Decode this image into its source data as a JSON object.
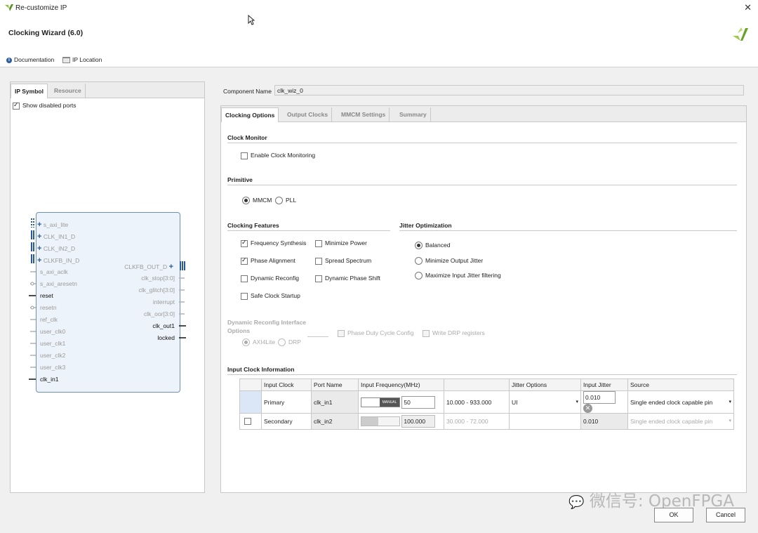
{
  "window": {
    "title": "Re-customize IP"
  },
  "header": {
    "title": "Clocking Wizard (6.0)",
    "links": [
      "Documentation",
      "IP Location"
    ]
  },
  "left_panel": {
    "tabs": [
      "IP Symbol",
      "Resource"
    ],
    "show_disabled_ports": "Show disabled ports",
    "symbol": {
      "left_ports": [
        "s_axi_lite",
        "CLK_IN1_D",
        "CLK_IN2_D",
        "CLKFB_IN_D",
        "s_axi_aclk",
        "s_axi_aresetn",
        "reset",
        "resetn",
        "ref_clk",
        "user_clk0",
        "user_clk1",
        "user_clk2",
        "user_clk3",
        "clk_in1"
      ],
      "right_ports": [
        "CLKFB_OUT_D",
        "clk_stop[3:0]",
        "clk_glitch[3:0]",
        "interrupt",
        "clk_oor[3:0]",
        "clk_out1",
        "locked"
      ]
    }
  },
  "component": {
    "label": "Component Name",
    "value": "clk_wiz_0"
  },
  "tabs": [
    "Clocking Options",
    "Output Clocks",
    "MMCM Settings",
    "Summary"
  ],
  "clock_monitor": {
    "title": "Clock Monitor",
    "enable": "Enable Clock Monitoring"
  },
  "primitive": {
    "title": "Primitive",
    "options": [
      "MMCM",
      "PLL"
    ]
  },
  "clocking_features": {
    "title": "Clocking Features",
    "options": [
      "Frequency Synthesis",
      "Minimize Power",
      "Phase Alignment",
      "Spread Spectrum",
      "Dynamic Reconfig",
      "Dynamic Phase Shift",
      "Safe Clock Startup"
    ]
  },
  "jitter_optimization": {
    "title": "Jitter Optimization",
    "options": [
      "Balanced",
      "Minimize Output Jitter",
      "Maximize Input Jitter filtering"
    ]
  },
  "drp": {
    "title_line1": "Dynamic Reconfig Interface",
    "title_line2": "Options",
    "options": [
      "AXI4Lite",
      "DRP"
    ],
    "phase_duty": "Phase Duty Cycle Config",
    "write_drp": "Write DRP registers"
  },
  "input_clock": {
    "title": "Input Clock Information",
    "headers": [
      "Input Clock",
      "Port Name",
      "Input Frequency(MHz)",
      "",
      "Jitter Options",
      "Input Jitter",
      "Source"
    ],
    "rows": [
      {
        "name": "Primary",
        "port": "clk_in1",
        "mode": "MANUAL",
        "freq": "50",
        "range": "10.000 - 933.000",
        "jitter_opt": "UI",
        "jitter": "0.010",
        "source": "Single ended clock capable pin"
      },
      {
        "name": "Secondary",
        "port": "clk_in2",
        "mode": "",
        "freq": "100.000",
        "range": "30.000 - 72.000",
        "jitter_opt": "",
        "jitter": "0.010",
        "source": "Single ended clock capable pin"
      }
    ]
  },
  "buttons": {
    "ok": "OK",
    "cancel": "Cancel"
  },
  "watermark": "微信号: OpenFPGA"
}
